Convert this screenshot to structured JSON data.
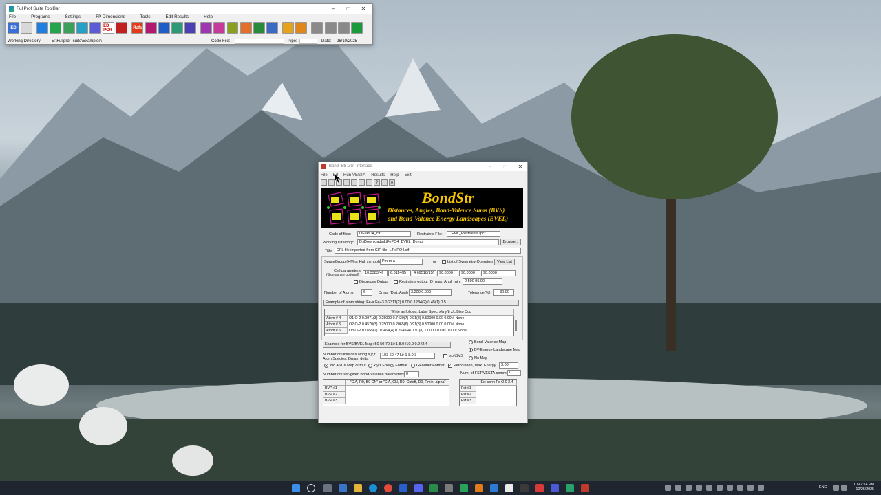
{
  "toolbar_window": {
    "title": "FullProf Suite ToolBar",
    "menu": [
      "File",
      "Programs",
      "Settings",
      "FP Dimensions",
      "Tools",
      "Edit Results",
      "Help"
    ],
    "icons": [
      {
        "name": "edpcr-icon",
        "color": "#3b6fd6",
        "text": "ED"
      },
      {
        "name": "notepad-icon",
        "color": "#d8d8d8",
        "text": ""
      },
      {
        "name": "diamond-tool-icon",
        "color": "#1f7fe0",
        "text": ""
      },
      {
        "name": "checkmark-icon",
        "color": "#26a34d",
        "text": ""
      },
      {
        "name": "graph-icon",
        "color": "#3aa05a",
        "text": ""
      },
      {
        "name": "fullprof-icon",
        "color": "#27a0c8",
        "text": ""
      },
      {
        "name": "winplotr-icon",
        "color": "#5b5bd6",
        "text": ""
      },
      {
        "name": "edpcr-text-icon",
        "color": "#ffffff",
        "text": "ED PCR"
      },
      {
        "name": "results-icon",
        "color": "#c02020",
        "text": ""
      },
      {
        "name": "rafs-icon",
        "color": "#e33a1a",
        "text": "Rafs"
      },
      {
        "name": "peak-icon",
        "color": "#b21a70",
        "text": ""
      },
      {
        "name": "plot-icon",
        "color": "#1f5ec8",
        "text": ""
      },
      {
        "name": "pattern-icon",
        "color": "#2c9a77",
        "text": ""
      },
      {
        "name": "cube-icon",
        "color": "#4c3fb5",
        "text": ""
      },
      {
        "name": "molecule-icon",
        "color": "#9e36b0",
        "text": ""
      },
      {
        "name": "crystal-icon",
        "color": "#c63a9a",
        "text": ""
      },
      {
        "name": "lattice-icon",
        "color": "#8aa01e",
        "text": ""
      },
      {
        "name": "bvs-icon",
        "color": "#e0702a",
        "text": ""
      },
      {
        "name": "pattern2-icon",
        "color": "#2a8a3c",
        "text": ""
      },
      {
        "name": "structure-icon",
        "color": "#3a6ac4",
        "text": ""
      },
      {
        "name": "gear-icon",
        "color": "#e6a21a",
        "text": ""
      },
      {
        "name": "gear2-icon",
        "color": "#e0861a",
        "text": ""
      },
      {
        "name": "mag-icon",
        "color": "#8a8a8a",
        "text": ""
      },
      {
        "name": "mag2-icon",
        "color": "#8a8a8a",
        "text": ""
      },
      {
        "name": "mag3-icon",
        "color": "#8a8a8a",
        "text": ""
      },
      {
        "name": "world-icon",
        "color": "#1a9a3a",
        "text": ""
      }
    ],
    "working_dir_label": "Working Directory:",
    "working_dir": "E:\\Fullprof_suite\\Examples\\",
    "code_file_label": "Code File:",
    "type_label": "Type:",
    "date_label": "Date:",
    "date": "26/10/2025"
  },
  "bond_window": {
    "title": "Bond_Str GUI-Interface",
    "menu": [
      "File",
      "Ed",
      "Run-VESTA",
      "Results",
      "Help",
      "Exit"
    ],
    "banner_title": "BondStr",
    "banner_line1": "Distances, Angles, Bond-Valence Sums (BVS)",
    "banner_line2": "and Bond-Valence Energy Landscapes (BVEL)",
    "code_label": "Code of files:",
    "code": "LiFePO4_cif",
    "restraints_label": "Restraints File:",
    "restraints": "CFML_Restraints.tpcr",
    "workdir_label": "Working Directory:",
    "workdir": "D:\\Downloads\\LiFePO4_BVEL_Demo",
    "browse": "Browse...",
    "title_label": "Title",
    "title_value": "CFL file imported from CIF-file: LiFePO4.cif",
    "spacegroup_label": "SpaceGroup (HM or Hall symbol)",
    "spacegroup": "P n m a",
    "or": "or",
    "list_symop": "List of Symmetry Operators",
    "view_list": "View List",
    "cell_label": "Cell parameters:",
    "cell_sub": "(Sigmas are optional)",
    "cell": [
      "10.3383(4)",
      "6.0114(2)",
      "4.69518(15)",
      "90.0000",
      "90.0000",
      "90.0000"
    ],
    "dist_output": "Distances Output",
    "restraints_output": "Restraints output",
    "dmax_angl_label": "D_max, Angl_min:",
    "dmax_angl": "2.500  95.00",
    "natoms_label": "Number of Atoms:",
    "natoms": "6",
    "dmax_label": "Dmax (Dist, Angl)",
    "dmax": "3.200  0.000",
    "tol_label": "Tolerance(%)",
    "tol": "30.00",
    "example_atom": "Example of atom string:   Fe-a     Fe+3     0.2311(2)    0.00    0.1234(2)    0.45(1)    0.5",
    "grid_header": "Write as follows: Label  Spec.   x/a   y/b   z/c  Biso   Occ",
    "atoms": [
      {
        "label": "Atom #  4",
        "row": "O1  O-2     0.0971(3)   0.25000   0.7430(7)   0.91(8)    0.50000      0.00   0.00   # None"
      },
      {
        "label": "Atom #  5",
        "row": "O2  O-2     0.4570(3)   0.25000   0.2065(6)   0.91(8)    0.50000      0.00   0.00   # None"
      },
      {
        "label": "Atom #  6",
        "row": "O3  O-2     0.1655(2)   0.0464(4)   0.2645(4)   0.91(8)    1.00000      0.00   0.00   # None"
      }
    ],
    "bvs_example": "Example for BVS/BVEL Map:   50     50     70     Li+1    8.0 /10.0    0.2 /2.4",
    "map_bv": "Bond-Valence Map",
    "map_bvel": "BV-Energy-Landscape Map",
    "map_no": "No Map",
    "ndiv_label1": "Number of Divisions along x,y,z,",
    "ndiv_label2": "Atom Species, Dmax_delta",
    "ndiv": "103 60 47 Li+1 8.0 3",
    "softbvs": "softBVS",
    "no_ascii": "No ASCII Map output",
    "xyz_energy": "x,y,z Energy Format",
    "gfourier": "GFourier Format",
    "percolation": "Percolation,   Max. Energy",
    "max_energy": "3.00",
    "nuser_label": "Number of user-given Bond-Valence parameters",
    "nuser": "0",
    "nfst_label": "Num. of FST/VESTA commands",
    "nfst": "0",
    "bvp_header": "\"C A, R0, B0 CN\" or \"C A, CN, R0, Cutoff, D0, Rmin, alpha\"",
    "bvp_rows": [
      "BVP #1",
      "BVP #2",
      "BVP #3"
    ],
    "fst_header": "Ex: conn Fe O 0 2.4",
    "fst_rows": [
      "Fst #1",
      "Fst #2",
      "Fst #3"
    ]
  },
  "taskbar": {
    "lang": "ENG",
    "time": "10:47:14 PM",
    "date": "10/26/2025"
  }
}
